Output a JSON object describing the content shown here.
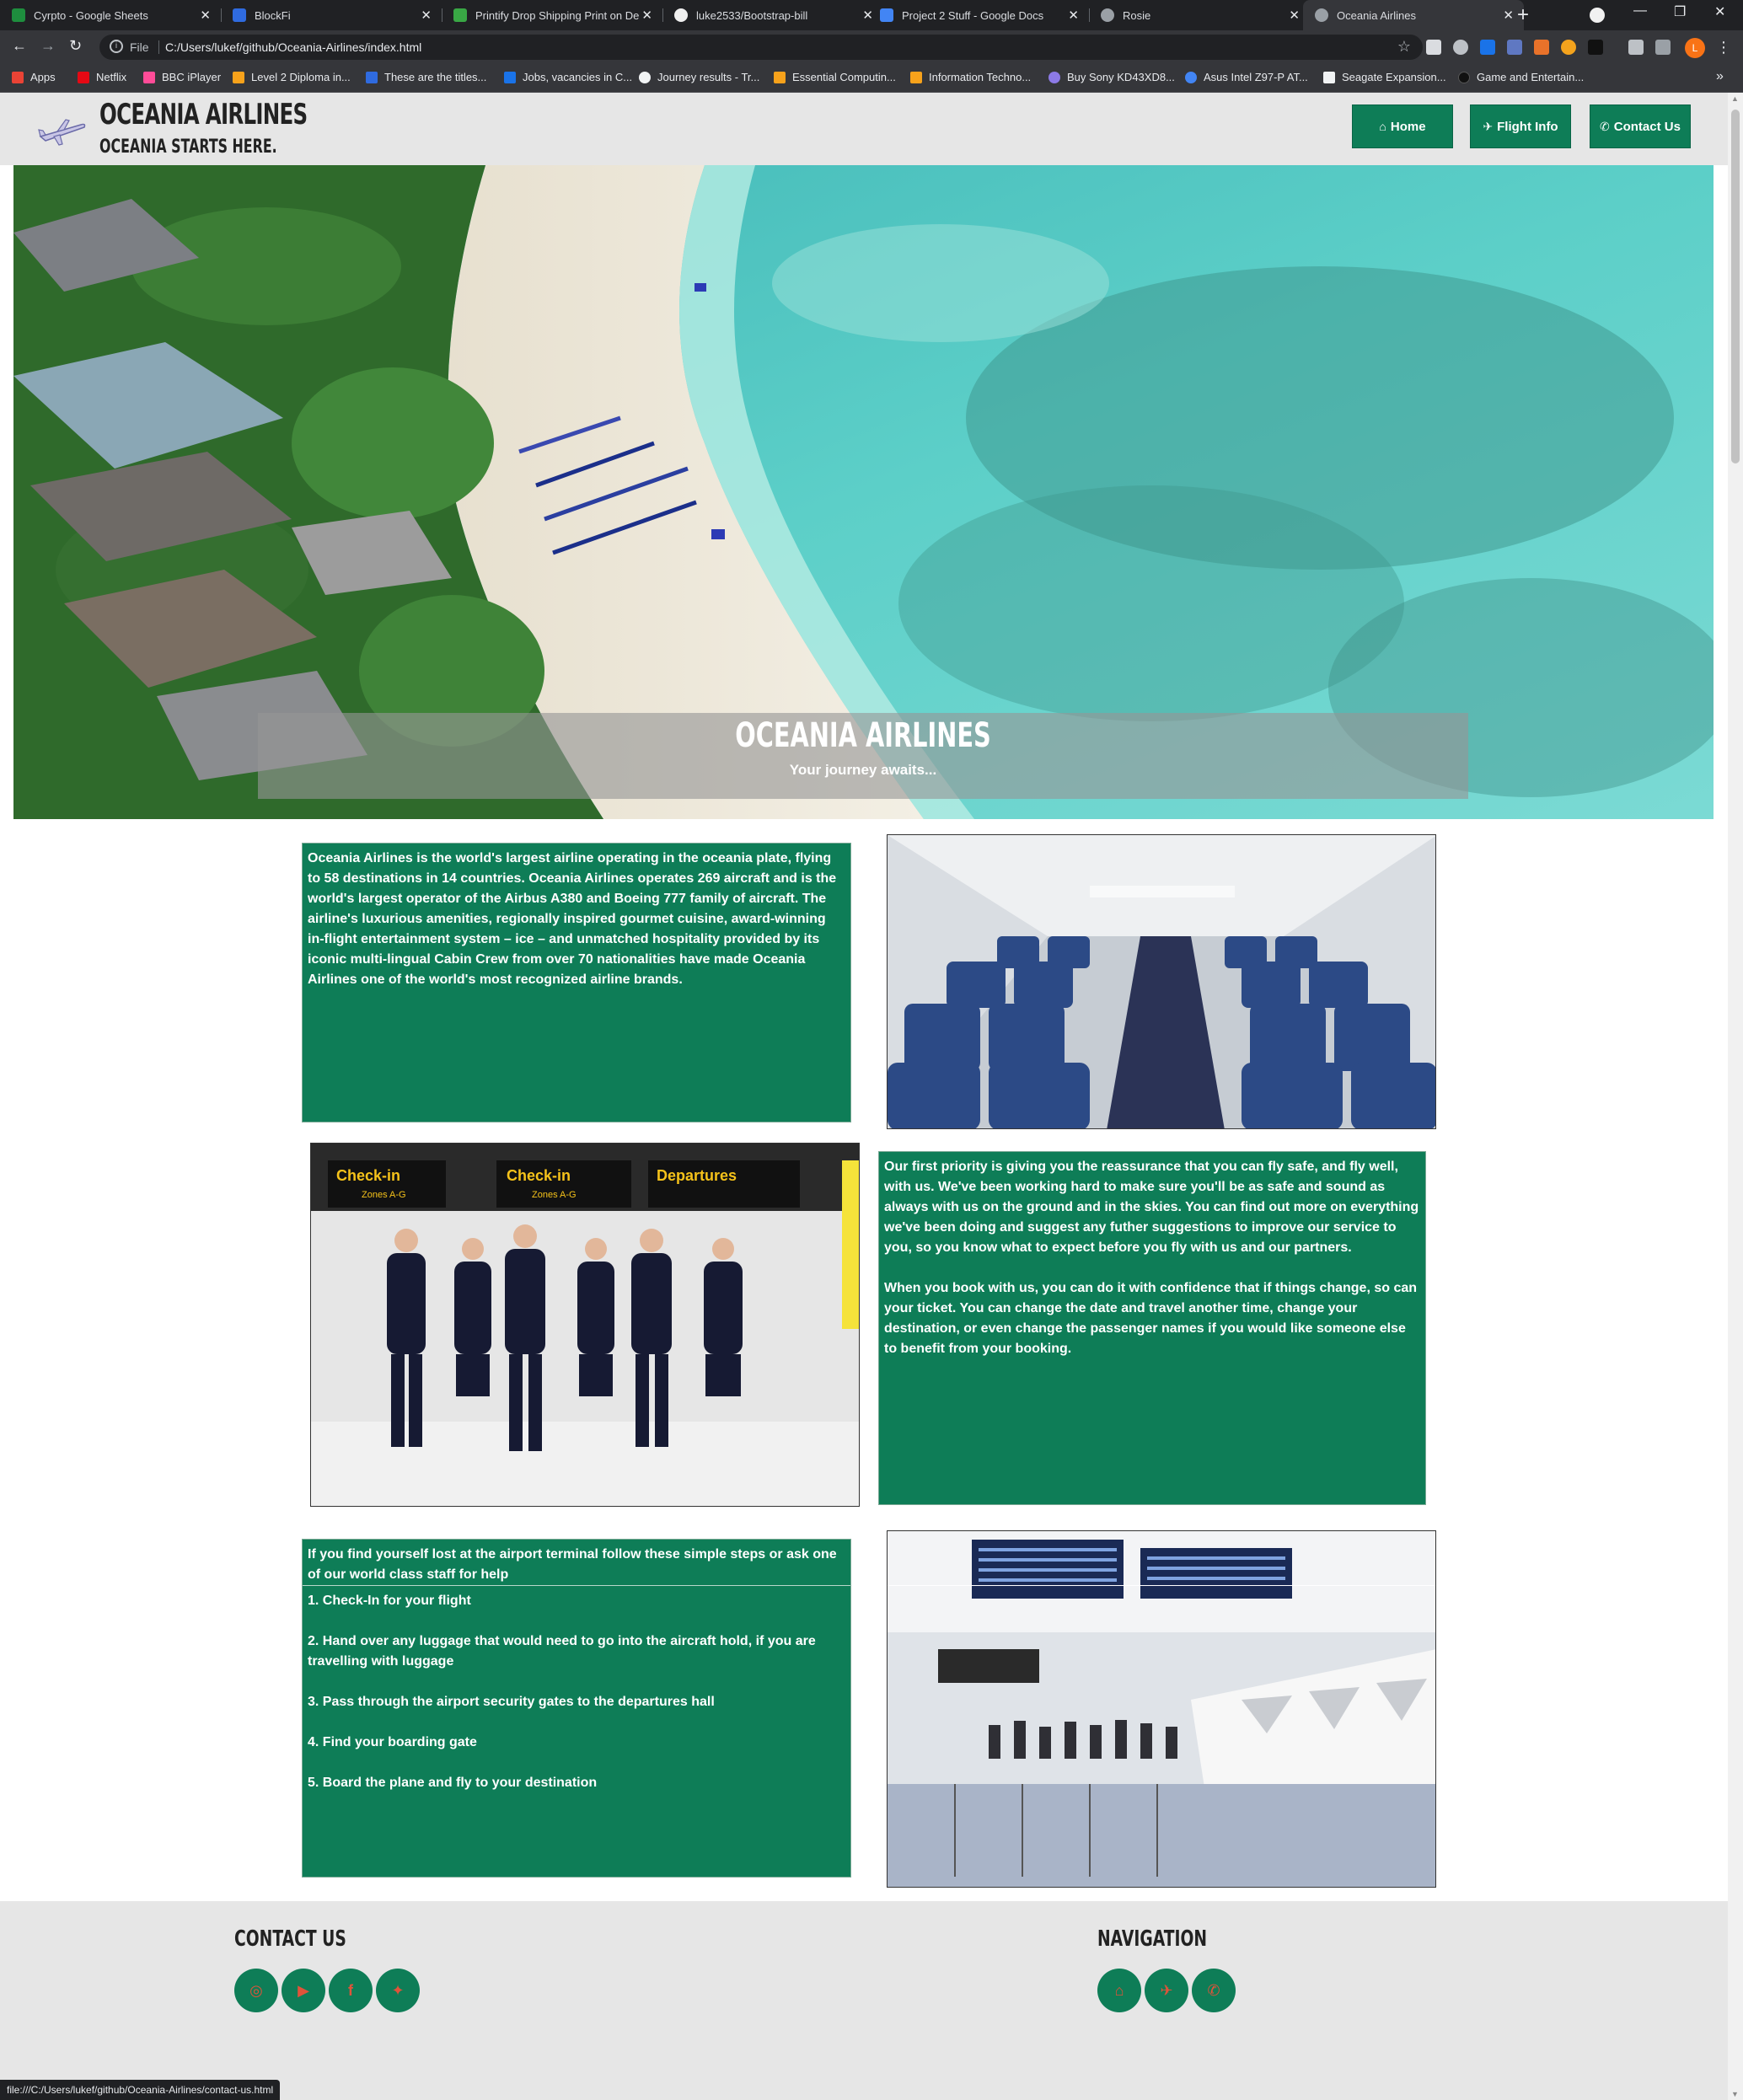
{
  "browser": {
    "tabs": [
      {
        "title": "Cyrpto - Google Sheets",
        "color": "#1e8e3e"
      },
      {
        "title": "BlockFi",
        "color": "#2f6be0"
      },
      {
        "title": "Printify Drop Shipping Print on De",
        "color": "#39a845"
      },
      {
        "title": "luke2533/Bootstrap-bill",
        "color": "#f0f0f0"
      },
      {
        "title": "Project 2 Stuff - Google Docs",
        "color": "#4285f4"
      },
      {
        "title": "Rosie",
        "color": "#9aa0a6"
      },
      {
        "title": "Oceania Airlines",
        "color": "#9aa0a6"
      }
    ],
    "active_tab": 6,
    "address": {
      "scheme_label": "File",
      "url": "C:/Users/lukef/github/Oceania-Airlines/index.html"
    },
    "profile_initial": "L",
    "bookmarks": [
      {
        "label": "Apps",
        "color": "#ea4335"
      },
      {
        "label": "Netflix",
        "color": "#e50914"
      },
      {
        "label": "BBC iPlayer",
        "color": "#ff4c98"
      },
      {
        "label": "Level 2 Diploma in...",
        "color": "#f7a21b"
      },
      {
        "label": "These are the titles...",
        "color": "#2f6be0"
      },
      {
        "label": "Jobs, vacancies in C...",
        "color": "#1a73e8"
      },
      {
        "label": "Journey results - Tr...",
        "color": "#f1f3f4"
      },
      {
        "label": "Essential Computin...",
        "color": "#f7a21b"
      },
      {
        "label": "Information Techno...",
        "color": "#f7a21b"
      },
      {
        "label": "Buy Sony KD43XD8...",
        "color": "#8c7ae6"
      },
      {
        "label": "Asus Intel Z97-P AT...",
        "color": "#4285f4"
      },
      {
        "label": "Seagate Expansion...",
        "color": "#f1f3f4"
      },
      {
        "label": "Game and Entertain...",
        "color": "#202124"
      }
    ],
    "status_url": "file:///C:/Users/lukef/github/Oceania-Airlines/contact-us.html"
  },
  "site": {
    "brand_title": "OCEANIA AIRLINES",
    "brand_subtitle": "OCEANIA STARTS HERE.",
    "nav": [
      {
        "label": "Home",
        "icon": "home-icon"
      },
      {
        "label": "Flight Info",
        "icon": "plane-icon"
      },
      {
        "label": "Contact Us",
        "icon": "phone-icon"
      }
    ],
    "hero": {
      "title": "OCEANIA AIRLINES",
      "subtitle": "Your journey awaits..."
    },
    "about_text": "Oceania Airlines is the world's largest airline operating in the oceania plate, flying to 58 destinations in 14 countries. Oceania Airlines operates 269 aircraft and is the world's largest operator of the Airbus A380 and Boeing 777 family of aircraft. The airline's luxurious amenities, regionally inspired gourmet cuisine, award-winning in-flight entertainment system – ice – and unmatched hospitality provided by its iconic multi-lingual Cabin Crew from over 70 nationalities have made Oceania Airlines one of the world's most recognized airline brands.",
    "priority_text_1": "Our first priority is giving you the reassurance that you can fly safe, and fly well, with us. We've been working hard to make sure you'll be as safe and sound as always with us on the ground and in the skies. You can find out more on everything we've been doing and suggest any futher suggestions to improve our service to you, so you know what to expect before you fly with us and our partners.",
    "priority_text_2": "When you book with us, you can do it with confidence that if things change, so can your ticket. You can change the date and travel another time, change your destination, or even change the passenger names if you would like someone else to benefit from your booking.",
    "steps_intro": "If you find yourself lost at the airport terminal follow these simple steps or ask one of our world class staff for help",
    "steps": [
      "1. Check-In for your flight",
      "2. Hand over any luggage that would need to go into the aircraft hold, if you are travelling with luggage",
      "3. Pass through the airport security gates to the departures hall",
      "4. Find your boarding gate",
      "5. Board the plane and fly to your destination"
    ],
    "crew_signs": [
      "Check-in",
      "Zones A-G",
      "Check-in",
      "Zones A-G",
      "Departures"
    ],
    "footer": {
      "contact_heading": "CONTACT US",
      "navigation_heading": "NAVIGATION",
      "social_icons": [
        "instagram-icon",
        "youtube-icon",
        "facebook-icon",
        "twitter-icon"
      ],
      "nav_icons": [
        "home-icon",
        "plane-icon",
        "phone-icon"
      ]
    },
    "colors": {
      "accent_green": "#0e7d57",
      "header_grey": "#e6e6e6",
      "icon_orange": "#e0533a"
    }
  }
}
